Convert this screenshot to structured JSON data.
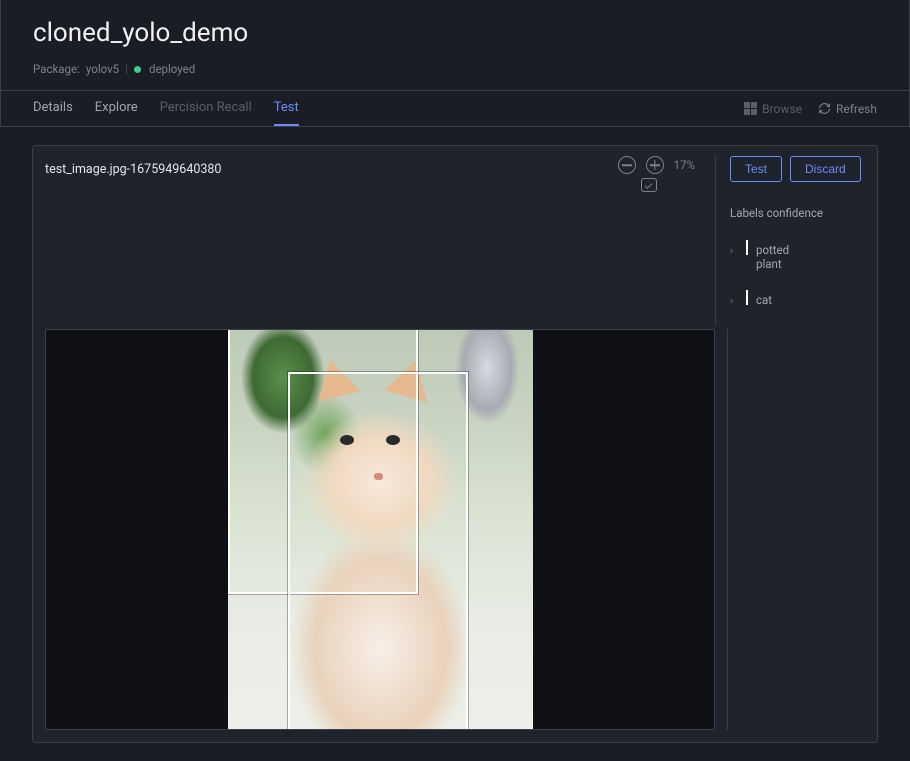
{
  "header": {
    "title": "cloned_yolo_demo",
    "package_label": "Package:",
    "package_name": "yolov5",
    "status": "deployed"
  },
  "tabs": {
    "details": "Details",
    "explore": "Explore",
    "precision_recall": "Percision Recall",
    "test": "Test"
  },
  "toolbar": {
    "browse": "Browse",
    "refresh": "Refresh"
  },
  "viewer": {
    "filename": "test_image.jpg-1675949640380",
    "zoom_pct": "17%"
  },
  "actions": {
    "test": "Test",
    "discard": "Discard"
  },
  "labels_panel": {
    "heading": "Labels confidence",
    "items": [
      {
        "name": "potted plant"
      },
      {
        "name": "cat"
      }
    ]
  }
}
